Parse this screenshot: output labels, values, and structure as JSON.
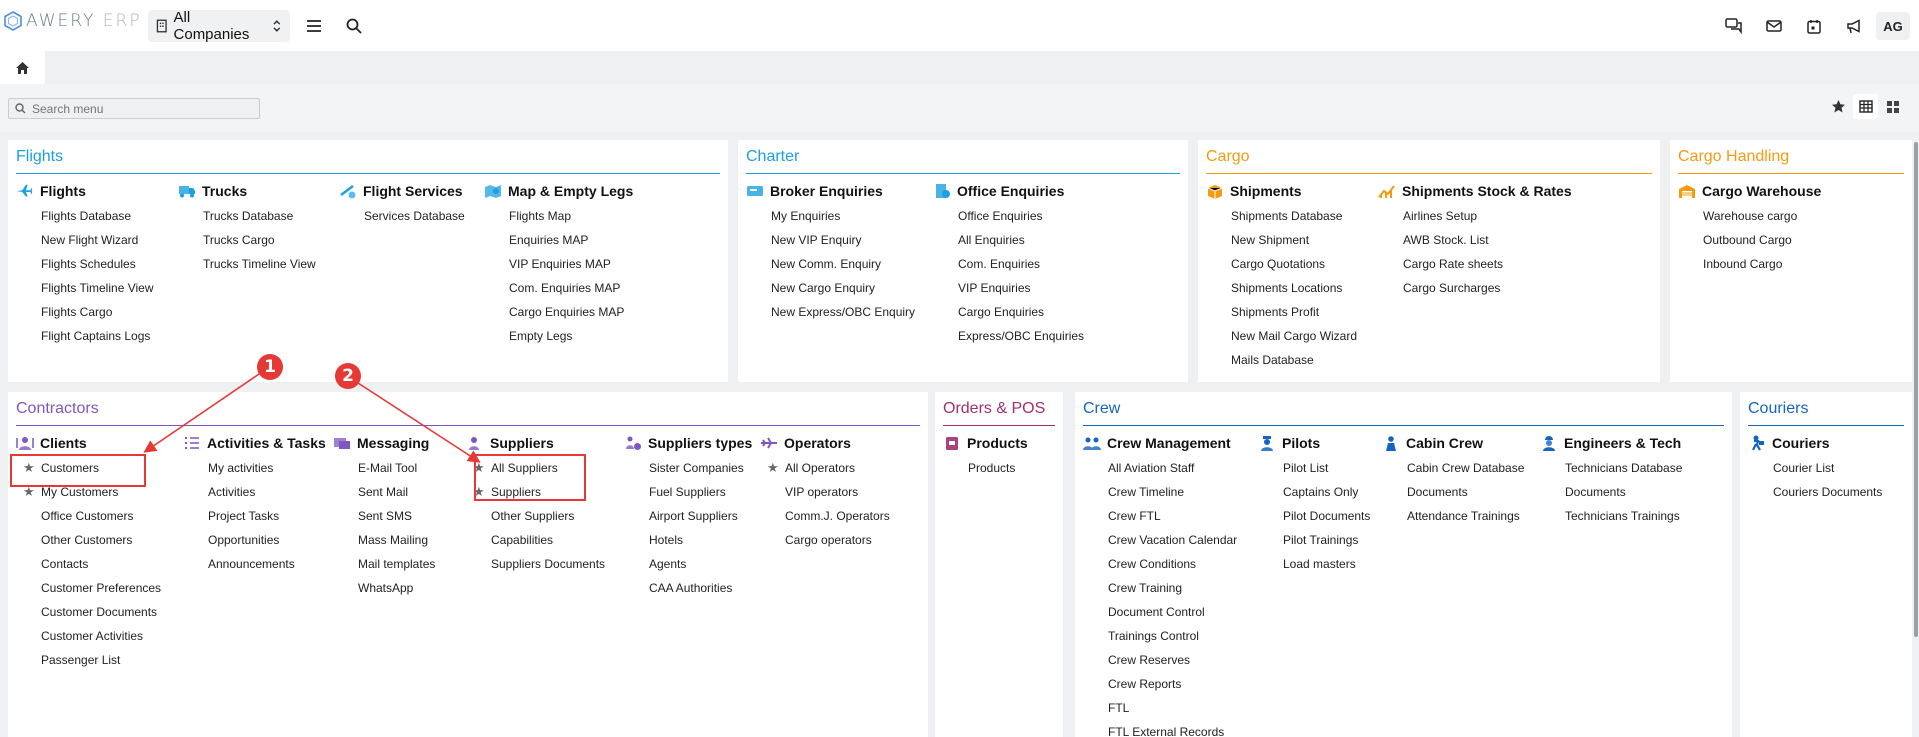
{
  "app": {
    "brand_main": "AWERY",
    "brand_suffix": "ERP",
    "company_select": "All Companies",
    "avatar_initials": "AG",
    "search_placeholder": "Search menu"
  },
  "colors": {
    "flights": "#1ba0e2",
    "charter": "#1ba0e2",
    "cargo": "#f39c12",
    "contractors": "#7e57c2",
    "orders": "#a0306f",
    "crew": "#1565c0",
    "couriers": "#1565c0",
    "annotation": "#e53935"
  },
  "sections": {
    "flights": {
      "title": "Flights",
      "columns": [
        {
          "icon": "airplane-icon",
          "title": "Flights",
          "items": [
            "Flights Database",
            "New Flight Wizard",
            "Flights Schedules",
            "Flights Timeline View",
            "Flights Cargo",
            "Flight Captains Logs"
          ]
        },
        {
          "icon": "truck-icon",
          "title": "Trucks",
          "items": [
            "Trucks Database",
            "Trucks Cargo",
            "Trucks Timeline View"
          ]
        },
        {
          "icon": "flight-services-icon",
          "title": "Flight Services",
          "items": [
            "Services Database"
          ]
        },
        {
          "icon": "map-icon",
          "title": "Map & Empty Legs",
          "items": [
            "Flights Map",
            "Enquiries MAP",
            "VIP Enquiries MAP",
            "Com. Enquiries MAP",
            "Cargo Enquiries MAP",
            "Empty Legs"
          ]
        }
      ]
    },
    "charter": {
      "title": "Charter",
      "columns": [
        {
          "icon": "broker-icon",
          "title": "Broker Enquiries",
          "items": [
            "My Enquiries",
            "New VIP Enquiry",
            "New Comm. Enquiry",
            "New Cargo Enquiry",
            "New Express/OBC Enquiry"
          ]
        },
        {
          "icon": "office-icon",
          "title": "Office Enquiries",
          "items": [
            "Office Enquiries",
            "All Enquiries",
            "Com. Enquiries",
            "VIP Enquiries",
            "Cargo Enquiries",
            "Express/OBC Enquiries"
          ]
        }
      ]
    },
    "cargo": {
      "title": "Cargo",
      "columns": [
        {
          "icon": "box-icon",
          "title": "Shipments",
          "items": [
            "Shipments Database",
            "New Shipment",
            "Cargo Quotations",
            "Shipments Locations",
            "Shipments Profit",
            "New Mail Cargo Wizard",
            "Mails Database"
          ]
        },
        {
          "icon": "chart-icon",
          "title": "Shipments Stock & Rates",
          "items": [
            "Airlines Setup",
            "AWB Stock. List",
            "Cargo Rate sheets",
            "Cargo Surcharges"
          ]
        }
      ]
    },
    "cargo_handling": {
      "title": "Cargo Handling",
      "columns": [
        {
          "icon": "warehouse-icon",
          "title": "Cargo Warehouse",
          "items": [
            "Warehouse cargo",
            "Outbound Cargo",
            "Inbound Cargo"
          ]
        }
      ]
    },
    "contractors": {
      "title": "Contractors",
      "columns": [
        {
          "icon": "clients-icon",
          "title": "Clients",
          "items": [
            "Customers",
            "My Customers",
            "Office Customers",
            "Other Customers",
            "Contacts",
            "Customer Preferences",
            "Customer Documents",
            "Customer Activities",
            "Passenger List"
          ],
          "starred": [
            0,
            1
          ]
        },
        {
          "icon": "tasks-icon",
          "title": "Activities & Tasks",
          "items": [
            "My activities",
            "Activities",
            "Project Tasks",
            "Opportunities",
            "Announcements"
          ]
        },
        {
          "icon": "messaging-icon",
          "title": "Messaging",
          "items": [
            "E-Mail Tool",
            "Sent Mail",
            "Sent SMS",
            "Mass Mailing",
            "Mail templates",
            "WhatsApp"
          ]
        },
        {
          "icon": "suppliers-icon",
          "title": "Suppliers",
          "items": [
            "All Suppliers",
            "Suppliers",
            "Other Suppliers",
            "Capabilities",
            "Suppliers Documents"
          ],
          "starred": [
            0,
            1
          ]
        },
        {
          "icon": "suppliers-types-icon",
          "title": "Suppliers types",
          "items": [
            "Sister Companies",
            "Fuel Suppliers",
            "Airport Suppliers",
            "Hotels",
            "Agents",
            "CAA Authorities"
          ]
        },
        {
          "icon": "operators-icon",
          "title": "Operators",
          "items": [
            "All Operators",
            "VIP operators",
            "Comm.J. Operators",
            "Cargo operators"
          ],
          "starred": [
            0
          ]
        }
      ]
    },
    "orders": {
      "title": "Orders & POS",
      "columns": [
        {
          "icon": "products-icon",
          "title": "Products",
          "items": [
            "Products"
          ]
        }
      ]
    },
    "crew": {
      "title": "Crew",
      "columns": [
        {
          "icon": "crew-icon",
          "title": "Crew Management",
          "items": [
            "All Aviation Staff",
            "Crew Timeline",
            "Crew FTL",
            "Crew Vacation Calendar",
            "Crew Conditions",
            "Crew Training",
            "Document Control",
            "Trainings Control",
            "Crew Reserves",
            "Crew Reports",
            "FTL",
            "FTL External Records"
          ]
        },
        {
          "icon": "pilot-icon",
          "title": "Pilots",
          "items": [
            "Pilot List",
            "Captains Only",
            "Pilot Documents",
            "Pilot Trainings",
            "Load masters"
          ]
        },
        {
          "icon": "cabin-crew-icon",
          "title": "Cabin Crew",
          "items": [
            "Cabin Crew Database",
            "Documents",
            "Attendance Trainings"
          ]
        },
        {
          "icon": "engineer-icon",
          "title": "Engineers & Tech",
          "items": [
            "Technicians Database",
            "Documents",
            "Technicians Trainings"
          ]
        }
      ]
    },
    "couriers": {
      "title": "Couriers",
      "columns": [
        {
          "icon": "courier-icon",
          "title": "Couriers",
          "items": [
            "Courier List",
            "Couriers Documents"
          ]
        }
      ]
    }
  },
  "annotations": {
    "callout_1": "1",
    "callout_2": "2"
  }
}
